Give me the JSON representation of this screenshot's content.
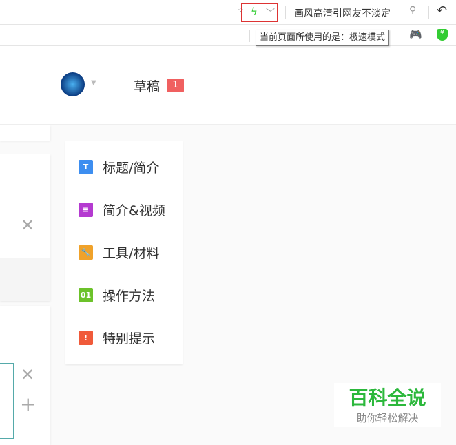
{
  "toolbar": {
    "search_text": "画风高清引网友不淡定",
    "tooltip": "当前页面所使用的是：极速模式"
  },
  "header": {
    "draft_label": "草稿",
    "draft_count": "1"
  },
  "nav": {
    "items": [
      {
        "label": "标题/简介",
        "icon": "T",
        "color": "#3d8ef0"
      },
      {
        "label": "简介&视频",
        "icon": "≡",
        "color": "#b43ad0"
      },
      {
        "label": "工具/材料",
        "icon": "🔧",
        "color": "#f0a22a"
      },
      {
        "label": "操作方法",
        "icon": "01",
        "color": "#6cc22a"
      },
      {
        "label": "特别提示",
        "icon": "!",
        "color": "#f05a3a"
      }
    ]
  },
  "watermark": {
    "title": "百科全说",
    "subtitle": "助你轻松解决"
  }
}
